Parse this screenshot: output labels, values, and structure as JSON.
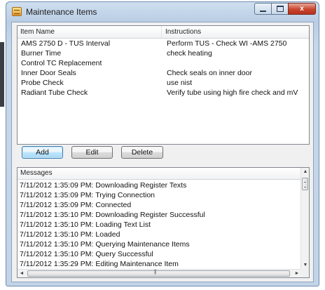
{
  "window": {
    "title": "Maintenance Items",
    "controls": {
      "minimize": "",
      "maximize": "",
      "close": "x"
    }
  },
  "items_list": {
    "columns": [
      "Item Name",
      "Instructions"
    ],
    "rows": [
      {
        "name": "AMS 2750 D - TUS Interval",
        "instructions": "Perform TUS - Check WI -AMS 2750"
      },
      {
        "name": "Burner Time",
        "instructions": "check heating"
      },
      {
        "name": "Control TC Replacement",
        "instructions": ""
      },
      {
        "name": "Inner Door Seals",
        "instructions": "Check seals on inner door"
      },
      {
        "name": "Probe Check",
        "instructions": "use nist"
      },
      {
        "name": "Radiant Tube Check",
        "instructions": "Verify tube using high fire check and mV"
      }
    ]
  },
  "buttons": {
    "add": "Add",
    "edit": "Edit",
    "delete": "Delete"
  },
  "messages": {
    "header": "Messages",
    "lines": [
      "7/11/2012 1:35:09 PM: Downloading Register Texts",
      "7/11/2012 1:35:09 PM: Trying Connection",
      "7/11/2012 1:35:09 PM: Connected",
      "7/11/2012 1:35:10 PM: Downloading Register Successful",
      "7/11/2012 1:35:10 PM: Loading Text List",
      "7/11/2012 1:35:10 PM: Loaded",
      "7/11/2012 1:35:10 PM: Querying Maintenance Items",
      "7/11/2012 1:35:10 PM: Query Successful",
      "7/11/2012 1:35:29 PM: Editing Maintenance Item"
    ],
    "scroll_up": "▲",
    "scroll_down": "▼",
    "scroll_left": "◄",
    "scroll_right": "►"
  }
}
